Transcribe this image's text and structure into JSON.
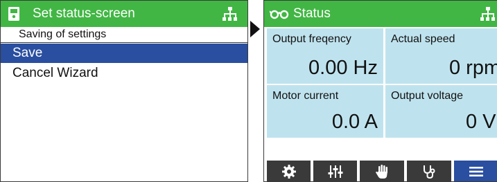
{
  "left_screen": {
    "title": "Set status-screen",
    "subtitle": "Saving of settings",
    "menu_items": [
      {
        "label": "Save",
        "selected": true
      },
      {
        "label": "Cancel Wizard",
        "selected": false
      }
    ],
    "icons": {
      "title_icon": "device-icon",
      "network_icon": "tree-icon"
    }
  },
  "right_screen": {
    "title": "Status",
    "icons": {
      "title_icon": "glasses-icon",
      "network_icon": "tree-icon"
    },
    "tiles": [
      {
        "label": "Output freqency",
        "value": "0.00 Hz"
      },
      {
        "label": "Actual speed",
        "value": "0 rpm"
      },
      {
        "label": "Motor current",
        "value": "0.0 A"
      },
      {
        "label": "Output voltage",
        "value": "0 V"
      }
    ],
    "tabs": [
      {
        "icon": "gear-icon",
        "active": false
      },
      {
        "icon": "sliders-icon",
        "active": false
      },
      {
        "icon": "hand-icon",
        "active": false
      },
      {
        "icon": "stethoscope-icon",
        "active": false
      },
      {
        "icon": "menu-icon",
        "active": true
      }
    ]
  },
  "colors": {
    "title_bar_green": "#41b644",
    "selection_blue": "#2a4ea0",
    "tile_blue": "#bfe3ee",
    "tab_dark": "#3a3a3a"
  }
}
